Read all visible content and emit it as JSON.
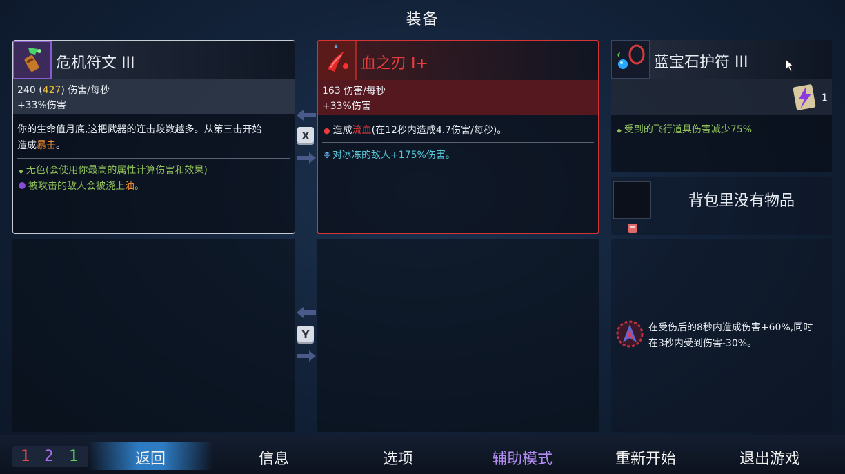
{
  "header": {
    "title": "装备"
  },
  "weapon1": {
    "name": "危机符文 III",
    "dps_base": "240",
    "dps_paren_open": "(",
    "dps_bonus": "427",
    "dps_paren_close": ")",
    "dps_unit": "伤害/每秒",
    "bonus": "+33%伤害",
    "desc_line1": "你的生命值月底,这把武器的连击段数越多。从第三击开始",
    "desc_line2_a": "造成",
    "desc_line2_b": "暴击",
    "desc_line2_c": "。",
    "mod1": "无色(会使用你最高的属性计算伤害和效果)",
    "mod2_a": "被攻击的敌人会被浇上",
    "mod2_b": "油",
    "mod2_c": "。"
  },
  "weapon2": {
    "name": "血之刃 I+",
    "dps": "163 伤害/每秒",
    "bonus": "+33%伤害",
    "effect_a": "造成",
    "effect_b": "流血",
    "effect_c": "(在12秒内造成4.7伤害/每秒)。",
    "mod1": "对冰冻的敌人+175%伤害。"
  },
  "amulet": {
    "name": "蓝宝石护符 III",
    "scroll_count": "1",
    "mod1": "受到的飞行道具伤害减少75%"
  },
  "backpack": {
    "empty_text": "背包里没有物品"
  },
  "mutation": {
    "line1": "在受伤后的8秒内造成伤害+60%,同时",
    "line2": "在3秒内受到伤害-30%。"
  },
  "swap_keys": {
    "top": "X",
    "bottom": "Y"
  },
  "scrolls": {
    "brutality": "1",
    "tactics": "2",
    "survival": "1"
  },
  "menu": {
    "back": "返回",
    "info": "信息",
    "options": "选项",
    "assist": "辅助模式",
    "restart": "重新开始",
    "quit": "退出游戏"
  },
  "colors": {
    "brutality": "#e84a4a",
    "tactics": "#b06cf0",
    "survival": "#5ad65a",
    "assist": "#b28cf0",
    "weapon2_border": "#d63434"
  }
}
